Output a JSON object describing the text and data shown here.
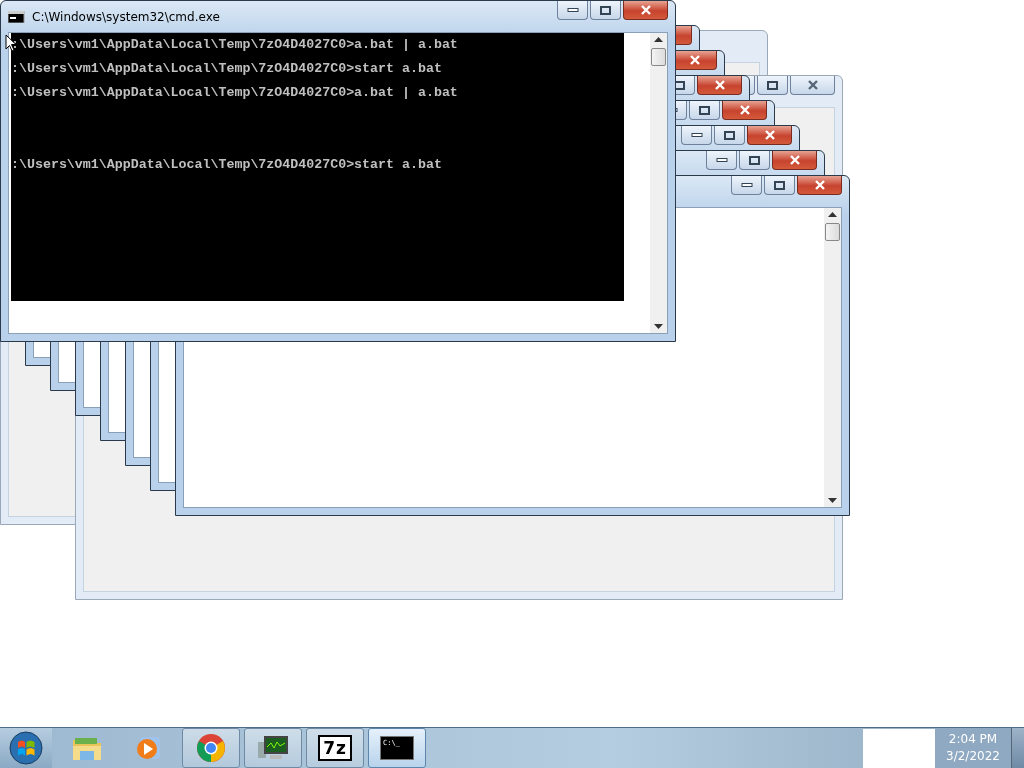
{
  "background_windows": [
    {
      "kind": "ghost"
    },
    {
      "kind": "ghost"
    },
    {
      "kind": "console"
    },
    {
      "kind": "console"
    },
    {
      "kind": "console"
    },
    {
      "kind": "console"
    },
    {
      "kind": "console"
    },
    {
      "kind": "console"
    },
    {
      "kind": "console"
    }
  ],
  "window": {
    "title": "C:\\Windows\\system32\\cmd.exe",
    "output": ":\\Users\\vm1\\AppData\\Local\\Temp\\7zO4D4027C0>a.bat | a.bat\n\n:\\Users\\vm1\\AppData\\Local\\Temp\\7zO4D4027C0>start a.bat\n\n:\\Users\\vm1\\AppData\\Local\\Temp\\7zO4D4027C0>a.bat | a.bat\n\n\n\n\n\n:\\Users\\vm1\\AppData\\Local\\Temp\\7zO4D4027C0>start a.bat"
  },
  "taskbar": {
    "items": [
      {
        "kind": "folder",
        "running": false,
        "active": false
      },
      {
        "kind": "media",
        "running": false,
        "active": false
      },
      {
        "kind": "browser",
        "running": true,
        "active": false
      },
      {
        "kind": "monitor",
        "running": true,
        "active": false
      },
      {
        "kind": "archive",
        "label": "7z",
        "running": true,
        "active": false
      },
      {
        "kind": "terminal",
        "label": "C:\\_",
        "running": true,
        "active": true
      }
    ],
    "clock": {
      "time": "2:04 PM",
      "date": "3/2/2022"
    }
  }
}
